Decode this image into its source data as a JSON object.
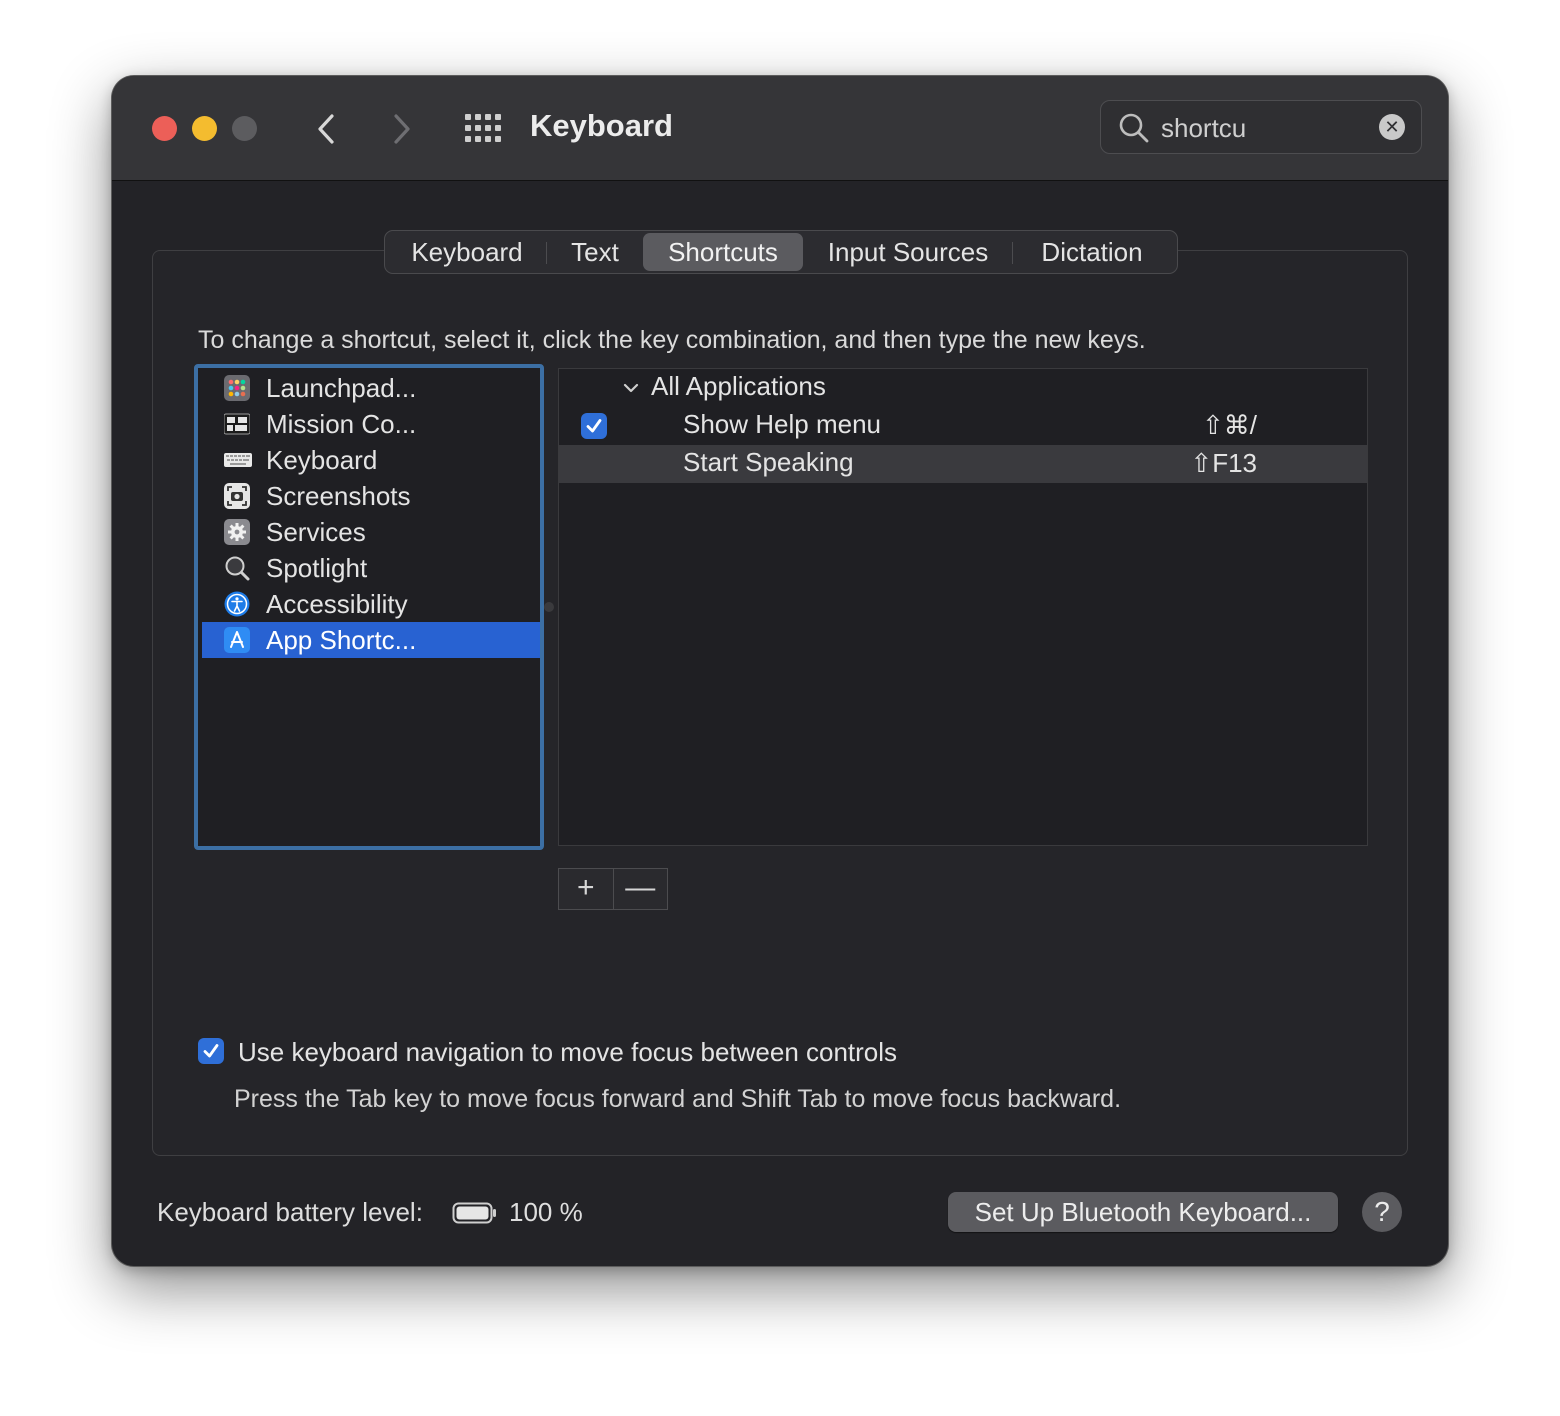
{
  "window": {
    "title": "Keyboard",
    "search": {
      "value": "shortcu",
      "placeholder": "Search"
    }
  },
  "tabs": [
    {
      "label": "Keyboard",
      "active": false
    },
    {
      "label": "Text",
      "active": false
    },
    {
      "label": "Shortcuts",
      "active": true
    },
    {
      "label": "Input Sources",
      "active": false
    },
    {
      "label": "Dictation",
      "active": false
    }
  ],
  "instruction": "To change a shortcut, select it, click the key combination, and then type the new keys.",
  "categories": [
    {
      "label": "Launchpad...",
      "icon": "launchpad-icon",
      "selected": false
    },
    {
      "label": "Mission Co...",
      "icon": "mission-control-icon",
      "selected": false
    },
    {
      "label": "Keyboard",
      "icon": "keyboard-icon",
      "selected": false
    },
    {
      "label": "Screenshots",
      "icon": "screenshot-icon",
      "selected": false
    },
    {
      "label": "Services",
      "icon": "services-gear-icon",
      "selected": false
    },
    {
      "label": "Spotlight",
      "icon": "spotlight-magnifier-icon",
      "selected": false
    },
    {
      "label": "Accessibility",
      "icon": "accessibility-icon",
      "selected": false
    },
    {
      "label": "App Shortc...",
      "icon": "app-store-icon",
      "selected": true
    }
  ],
  "shortcuts": {
    "group": "All Applications",
    "items": [
      {
        "name": "Show Help menu",
        "keys": "⇧⌘/",
        "checked": true,
        "highlighted": false
      },
      {
        "name": "Start Speaking",
        "keys": "⇧F13",
        "checked": false,
        "highlighted": true
      }
    ]
  },
  "buttons": {
    "add": "+",
    "remove": "—"
  },
  "keyboard_nav": {
    "checked": true,
    "label": "Use keyboard navigation to move focus between controls",
    "description": "Press the Tab key to move focus forward and Shift Tab to move focus backward."
  },
  "footer": {
    "battery_label": "Keyboard battery level:",
    "battery_value": "100 %",
    "battery_level_percent": 100,
    "bluetooth_button": "Set Up Bluetooth Keyboard...",
    "help_button": "?"
  },
  "colors": {
    "accent": "#2862d2",
    "focus_ring": "#3c6fa4",
    "close": "#ec5f58",
    "minimize": "#f4bc2f",
    "zoom": "#5c5c5f"
  }
}
